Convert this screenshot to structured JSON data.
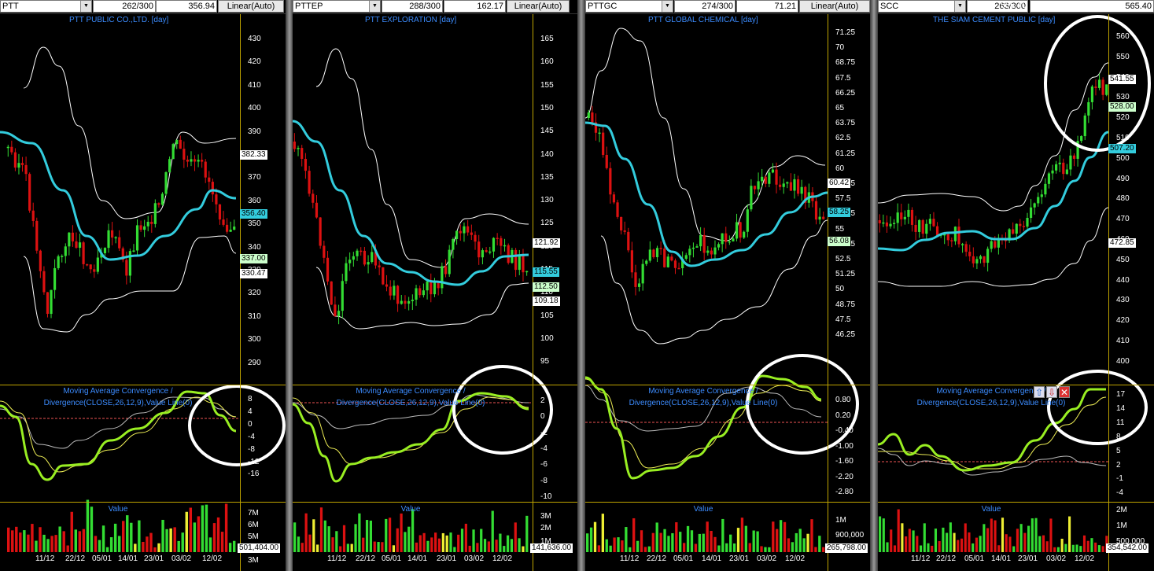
{
  "colors": {
    "bull": "#33dd33",
    "bear": "#dd1111",
    "ma": "#33ccdd",
    "macd": "#99ee22",
    "signal": "#eeee55",
    "hist": "#bbbbbb",
    "band": "#ffffff",
    "zero": "#ee5555",
    "axis": "#bfa400",
    "circle": "#ffffff"
  },
  "icons": {
    "dropdown": "chevron-down-icon",
    "up": "arrow-up-icon",
    "down": "arrow-down-icon",
    "close": "close-icon"
  },
  "panels": [
    {
      "symbol": "PTT",
      "bars": "262/300",
      "last": "356.94",
      "scale": "Linear(Auto)",
      "title": "PTT PUBLIC CO.,LTD. [day]",
      "price_ticks": [
        "430",
        "420",
        "410",
        "400",
        "390",
        "380",
        "370",
        "360",
        "350",
        "340",
        "330",
        "320",
        "310",
        "300",
        "290"
      ],
      "labels": {
        "upper": "382.33",
        "ma": "356.40",
        "close": "337.00",
        "lower": "330.47"
      },
      "macd_title": "Moving Average Convergence / Divergence(CLOSE,26,12,9),Value Line(0)",
      "macd_ticks": [
        "8",
        "4",
        "0",
        "-4",
        "-8",
        "-12",
        "-16"
      ],
      "vol_title": "Value",
      "vol_ticks": [
        "7M",
        "6M",
        "5M",
        "4M",
        "3M"
      ],
      "vol_label": "501,404.00",
      "xticks": [
        "11/12",
        "22/12",
        "05/01",
        "14/01",
        "23/01",
        "03/02",
        "12/02"
      ]
    },
    {
      "symbol": "PTTEP",
      "bars": "288/300",
      "last": "162.17",
      "scale": "Linear(Auto)",
      "title": "PTT EXPLORATION [day]",
      "price_ticks": [
        "165",
        "160",
        "155",
        "150",
        "145",
        "140",
        "135",
        "130",
        "125",
        "120",
        "115",
        "110",
        "105",
        "100",
        "95"
      ],
      "labels": {
        "upper": "121.92",
        "ma": "115.55",
        "close": "112.50",
        "lower": "109.18"
      },
      "macd_title": "Moving Average Convergence / Divergence(CLOSE,26,12,9),Value Line(0)",
      "macd_ticks": [
        "2",
        "0",
        "-2",
        "-4",
        "-6",
        "-8",
        "-10"
      ],
      "vol_title": "Value",
      "vol_ticks": [
        "3M",
        "2M",
        "1M"
      ],
      "vol_label": "141,636.00",
      "xticks": [
        "11/12",
        "22/12",
        "05/01",
        "14/01",
        "23/01",
        "03/02",
        "12/02"
      ]
    },
    {
      "symbol": "PTTGC",
      "bars": "274/300",
      "last": "71.21",
      "scale": "Linear(Auto)",
      "title": "PTT GLOBAL CHEMICAL [day]",
      "price_ticks": [
        "71.25",
        "70",
        "68.75",
        "67.5",
        "66.25",
        "65",
        "63.75",
        "62.5",
        "61.25",
        "60",
        "58.75",
        "57.5",
        "56.25",
        "55",
        "53.75",
        "52.5",
        "51.25",
        "50",
        "48.75",
        "47.5",
        "46.25"
      ],
      "labels": {
        "upper": "60.42",
        "ma": "58.25",
        "close": "56.08",
        "lower": ""
      },
      "macd_title": "Moving Average Convergence / Divergence(CLOSE,26,12,9),Value Line(0)",
      "macd_ticks": [
        "0.80",
        "0.20",
        "-0.40",
        "-1.00",
        "-1.60",
        "-2.20",
        "-2.80"
      ],
      "vol_title": "Value",
      "vol_ticks": [
        "1M",
        "900,000"
      ],
      "vol_label": "265,798.00",
      "xticks": [
        "11/12",
        "22/12",
        "05/01",
        "14/01",
        "23/01",
        "03/02",
        "12/02"
      ]
    },
    {
      "symbol": "SCC",
      "bars": "263/300",
      "last": "565.40",
      "scale": "Recal Scale-Linear",
      "title": "THE SIAM CEMENT PUBLIC [day]",
      "price_ticks": [
        "560",
        "550",
        "540",
        "530",
        "520",
        "510",
        "500",
        "490",
        "480",
        "470",
        "460",
        "450",
        "440",
        "430",
        "420",
        "410",
        "400"
      ],
      "labels": {
        "upper": "541.55",
        "ma": "507.20",
        "close": "528.00",
        "lower": "472.85"
      },
      "macd_title": "Moving Average Convergence / Divergence(CLOSE,26,12,9),Value Line(0)",
      "macd_ticks": [
        "17",
        "14",
        "11",
        "8",
        "5",
        "2",
        "-1",
        "-4"
      ],
      "vol_title": "Value",
      "vol_ticks": [
        "2M",
        "1M",
        "500,000"
      ],
      "vol_label": "354,542.00",
      "xticks": [
        "11/12",
        "22/12",
        "05/01",
        "14/01",
        "23/01",
        "03/02",
        "12/02"
      ]
    }
  ]
}
